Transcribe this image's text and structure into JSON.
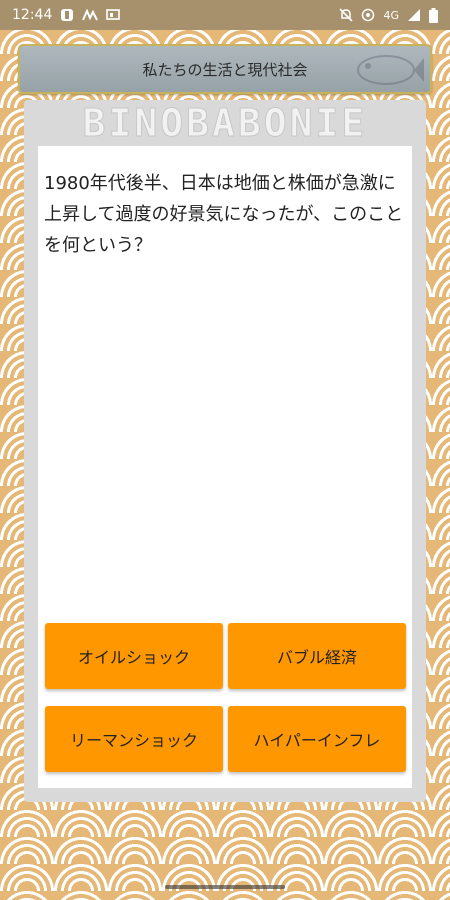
{
  "status_bar": {
    "time": "12:44",
    "network": "4G",
    "left_icons": [
      "app-notification-icon",
      "signal-wave-icon",
      "cast-icon"
    ],
    "right_icons": [
      "mute-icon",
      "wifi-calling-icon",
      "cellular-signal-icon",
      "battery-icon"
    ]
  },
  "header": {
    "title": "私たちの生活と現代社会"
  },
  "banner": {
    "text": "BINOBABONIE"
  },
  "question": {
    "text": "1980年代後半、日本は地価と株価が急激に上昇して過度の好景気になったが、このことを何という？"
  },
  "answers": [
    {
      "label": "オイルショック"
    },
    {
      "label": "バブル経済"
    },
    {
      "label": "リーマンショック"
    },
    {
      "label": "ハイパーインフレ"
    }
  ],
  "colors": {
    "accent": "#ff9800",
    "background": "#e6b877",
    "header": "#a4afb4",
    "status_bar": "#a7916c"
  }
}
